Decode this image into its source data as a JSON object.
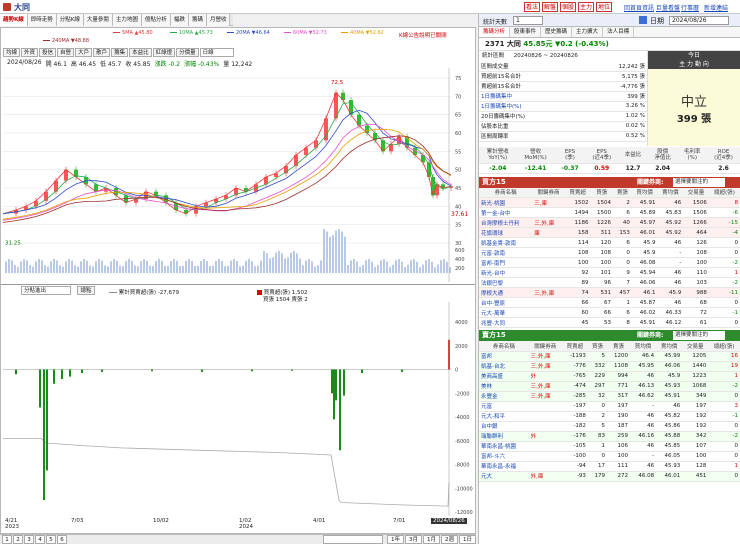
{
  "app": {
    "title": "大同"
  },
  "top_buttons": [
    "看法",
    "解盤",
    "個股",
    "主力",
    "地位"
  ],
  "top_links": [
    "回首頁資訊",
    "巨量看盤",
    "行事曆",
    "新增連結"
  ],
  "tabs": [
    "趨勢K線",
    "即時走勢",
    "分點K線",
    "大量參閱",
    "主力地圖",
    "億點分析",
    "幅跌",
    "籌碼",
    "月營收"
  ],
  "active_tab": 0,
  "ma_legend": [
    {
      "label": "5MA ▲45.80",
      "color": "#e23b3b"
    },
    {
      "label": "10MA ▲45.73",
      "color": "#2aa84a"
    },
    {
      "label": "20MA ▼46.64",
      "color": "#2f4ec9"
    },
    {
      "label": "60MA ▼52.73",
      "color": "#e54fd0"
    },
    {
      "label": "40MA ▼52.62",
      "color": "#e8a000"
    },
    {
      "label": "240MA ▼48.88",
      "color": "#9b2a2a"
    }
  ],
  "ma_note": "K線公告說明已關閉",
  "ind_buttons": [
    "均線",
    "外資",
    "投信",
    "自營",
    "大戶",
    "散戶",
    "籌集",
    "本益比",
    "紅綠燈",
    "分價量",
    "日線"
  ],
  "quote": {
    "date": "2024/08/26",
    "open_l": "開",
    "open": "46.1",
    "high_l": "高",
    "high": "46.45",
    "low_l": "低",
    "low": "45.7",
    "close_l": "收",
    "close": "45.85",
    "chg_l": "漲跌",
    "chg": "-0.2",
    "pct_l": "漲幅",
    "pct": "-0.43%",
    "vol_l": "量",
    "vol": "12,242"
  },
  "price_axis": [
    "75",
    "70",
    "65",
    "60",
    "55",
    "50",
    "45",
    "40",
    "35",
    "30"
  ],
  "price_annot": {
    "high": "72.5",
    "low": "31.25",
    "last": "37.61"
  },
  "vol_axis": [
    "600",
    "400",
    "200"
  ],
  "lower": {
    "select": "分點進出",
    "btn": "總點",
    "legend1": "累計買賣超(張) -27,679",
    "legend2": "買賣超(張) 1,502",
    "legend3": "買張 1504 賣張 2"
  },
  "lower_axis": [
    "4000",
    "2000",
    "0",
    "-2000",
    "-4000",
    "-6000",
    "-8000",
    "-10000",
    "-12000"
  ],
  "date_axis": [
    "4/21\n2023",
    "7/03",
    "10/02",
    "1/02\n2024",
    "4/01",
    "7/01",
    "2024/08/26"
  ],
  "pages": [
    "1",
    "2",
    "3",
    "4",
    "5",
    "6"
  ],
  "bottom_ranges": [
    "1年",
    "3月",
    "1月",
    "2週",
    "1日"
  ],
  "rp_header": {
    "label": "統計天數",
    "days": "1",
    "date_label": "日期",
    "date": "2024/08/26"
  },
  "rp_tabs": [
    "籌碼分析",
    "股東事件",
    "歷史籌碼",
    "主力擴大",
    "法人目標"
  ],
  "stock_line": {
    "code": "2371 大同",
    "price": "45.85元",
    "chg": "▼0.2 (-0.43%)"
  },
  "stats": {
    "range_l": "統計區間",
    "range": "20240826 ~ 20240826",
    "rows": [
      {
        "k": "區間成交量",
        "v": "12,242 張"
      },
      {
        "k": "買超前15名合計",
        "v": "5,175 張"
      },
      {
        "k": "賣超前15名合計",
        "v": "-4,776 張"
      },
      {
        "k": "1日籌碼集中",
        "v": "399 張"
      },
      {
        "k": "1日籌碼集中(%)",
        "v": "3.26 %"
      },
      {
        "k": "20日籌碼集中(%)",
        "v": "1.02 %"
      },
      {
        "k": "佔股本比重",
        "v": "0.02 %"
      },
      {
        "k": "區間周轉率",
        "v": "0.52 %"
      }
    ],
    "today_l": "今日",
    "today_sub": "主 力 動 向",
    "direction": "中立",
    "direction_val": "399 張"
  },
  "metrics": {
    "headers": [
      "累計營收\nYoY(%)",
      "營收\nMoM(%)",
      "EPS\n(季)",
      "EPS\n(近4季)",
      "本益比",
      "股價\n淨值比",
      "毛利率\n(%)",
      "ROE\n(近4季)"
    ],
    "values": [
      "-2.04",
      "-12.41",
      "-0.37",
      "0.59",
      "12.7",
      "2.04",
      "",
      "2.6"
    ]
  },
  "buy_section": {
    "title": "買方15",
    "label": "關鍵券商:",
    "select": "選擇要關注的",
    "cols": [
      "券商名稱",
      "關鍵券商",
      "買賣超",
      "買張",
      "賣張",
      "買均價",
      "賣均價",
      "交易量",
      "總超(張)"
    ],
    "rows": [
      [
        "新光-桃園",
        "三,庫",
        "1502",
        "1504",
        "2",
        "45.91",
        "46",
        "1506",
        "8"
      ],
      [
        "第一金-台中",
        "",
        "1494",
        "1500",
        "6",
        "45.89",
        "45.83",
        "1506",
        "-6"
      ],
      [
        "台灣摩根士丹利",
        "三,外,庫",
        "1186",
        "1226",
        "40",
        "45.97",
        "45.92",
        "1266",
        "-15"
      ],
      [
        "花旗環球",
        "庫",
        "158",
        "311",
        "153",
        "46.01",
        "45.92",
        "464",
        "-4"
      ],
      [
        "凱基金貴-敦南",
        "",
        "114",
        "120",
        "6",
        "45.9",
        "46",
        "126",
        "0"
      ],
      [
        "元富-敦南",
        "",
        "108",
        "108",
        "0",
        "45.9",
        "-",
        "108",
        "0"
      ],
      [
        "富邦-南門",
        "",
        "100",
        "100",
        "0",
        "46.08",
        "-",
        "100",
        "-2"
      ],
      [
        "新光-台中",
        "",
        "92",
        "101",
        "9",
        "45.94",
        "46",
        "110",
        "1"
      ],
      [
        "法銀巴黎",
        "",
        "89",
        "96",
        "7",
        "46.06",
        "46",
        "103",
        "-2"
      ],
      [
        "摩根大通",
        "三,外,庫",
        "74",
        "531",
        "457",
        "46.1",
        "45.9",
        "988",
        "-11"
      ],
      [
        "台中-豐原",
        "",
        "66",
        "67",
        "1",
        "45.87",
        "46",
        "68",
        "0"
      ],
      [
        "元大-萬華",
        "",
        "60",
        "66",
        "6",
        "46.02",
        "46.33",
        "72",
        "-1"
      ],
      [
        "兆豐-大同",
        "",
        "45",
        "53",
        "8",
        "45.91",
        "46.12",
        "61",
        "0"
      ]
    ]
  },
  "sell_section": {
    "title": "賣方15",
    "label": "關鍵券商:",
    "select": "選擇要關注的",
    "cols": [
      "券商名稱",
      "關鍵券商",
      "買賣超",
      "買張",
      "賣張",
      "買均價",
      "賣均價",
      "交易量",
      "總超(張)"
    ],
    "rows": [
      [
        "富邦",
        "三,外,庫",
        "-1193",
        "5",
        "1200",
        "46.4",
        "45.99",
        "1205",
        "16"
      ],
      [
        "凱基-台北",
        "三,外,庫",
        "-776",
        "332",
        "1108",
        "45.95",
        "46.06",
        "1440",
        "19"
      ],
      [
        "美商高盛",
        "外",
        "-765",
        "229",
        "994",
        "46",
        "45.9",
        "1223",
        "1"
      ],
      [
        "美林",
        "三,外,庫",
        "-474",
        "297",
        "771",
        "46.13",
        "45.93",
        "1068",
        "-2"
      ],
      [
        "永豐金",
        "三,外,庫",
        "-285",
        "32",
        "317",
        "46.62",
        "45.91",
        "349",
        "0"
      ],
      [
        "元富",
        "",
        "-197",
        "0",
        "197",
        "-",
        "46",
        "197",
        "3"
      ],
      [
        "元大-和平",
        "",
        "-188",
        "2",
        "190",
        "46",
        "45.82",
        "192",
        "-1"
      ],
      [
        "台中銀",
        "",
        "-182",
        "5",
        "187",
        "46",
        "45.86",
        "192",
        "0"
      ],
      [
        "瑞聯群利",
        "外",
        "-176",
        "83",
        "259",
        "46.16",
        "45.88",
        "342",
        "-2"
      ],
      [
        "華南永昌-桃園",
        "",
        "-105",
        "1",
        "106",
        "46",
        "45.85",
        "107",
        "0"
      ],
      [
        "富邦-斗六",
        "",
        "-100",
        "0",
        "100",
        "-",
        "46.05",
        "100",
        "0"
      ],
      [
        "華南永昌-永福",
        "",
        "-94",
        "17",
        "111",
        "46",
        "45.93",
        "128",
        "1"
      ],
      [
        "元大",
        "外,庫",
        "-93",
        "179",
        "272",
        "46.08",
        "46.01",
        "451",
        "0"
      ]
    ]
  }
}
